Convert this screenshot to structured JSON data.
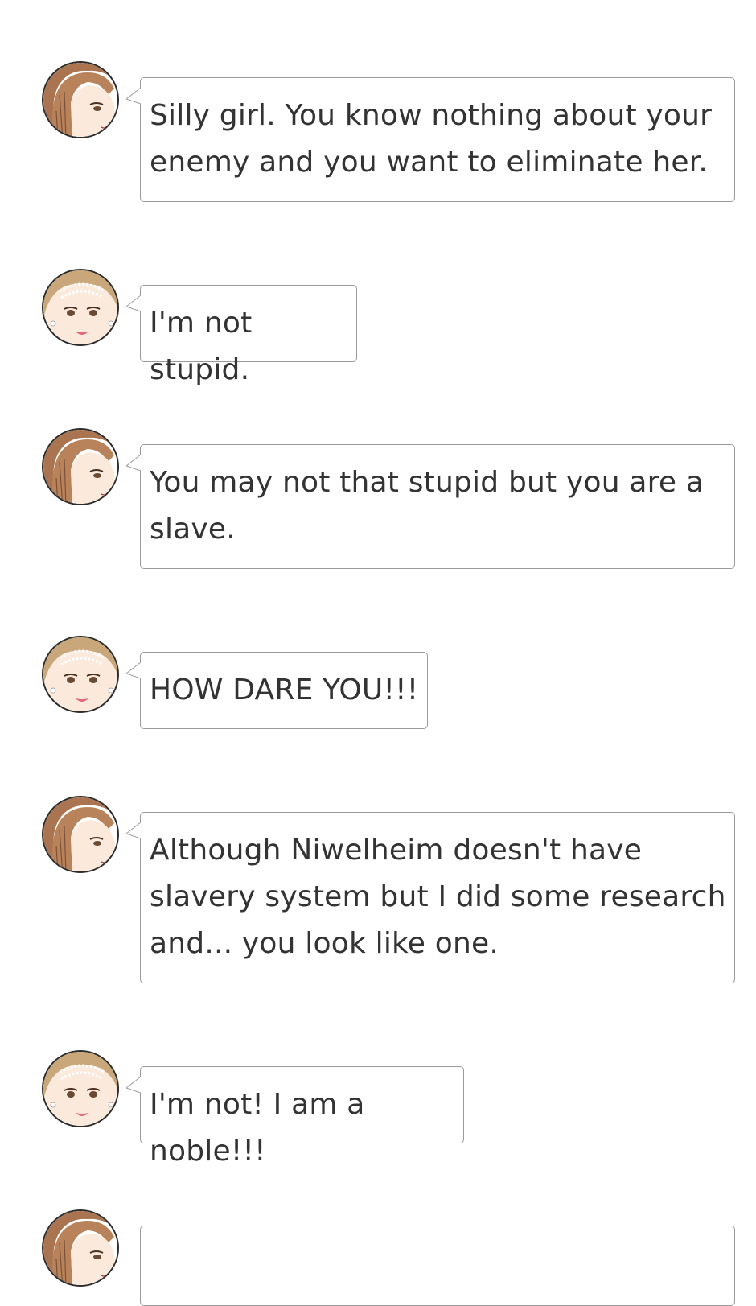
{
  "messages": [
    {
      "speaker": "brown-haired-girl",
      "text": "Silly girl. You know nothing about your enemy and you want to eliminate her."
    },
    {
      "speaker": "noble-girl",
      "text": "I'm not stupid."
    },
    {
      "speaker": "brown-haired-girl",
      "text": "You may not that stupid but you are a slave."
    },
    {
      "speaker": "noble-girl",
      "text": "HOW DARE YOU!!!"
    },
    {
      "speaker": "brown-haired-girl",
      "text": "Although Niwelheim doesn't have slavery system but I did some research and... you look like one."
    },
    {
      "speaker": "noble-girl",
      "text": "I'm not! I am a noble!!!"
    },
    {
      "speaker": "brown-haired-girl",
      "text": ""
    }
  ],
  "colors": {
    "bubble_border": "#9a9a9a",
    "text": "#333333",
    "hair_brown": "#a9744f",
    "hair_blonde": "#c9a77a",
    "skin": "#fbe9dc"
  }
}
